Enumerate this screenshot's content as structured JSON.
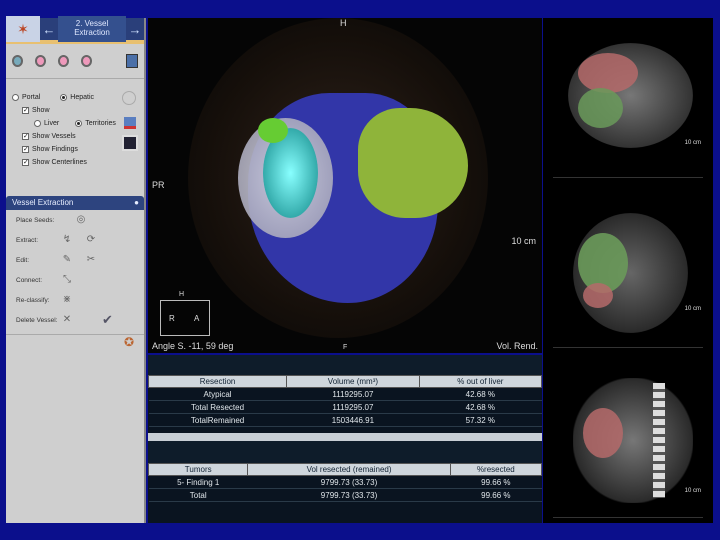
{
  "toolbar": {
    "step": "2. Vessel Extraction",
    "back": "←",
    "next": "→"
  },
  "options": {
    "portal": "Portal",
    "hepatic": "Hepatic",
    "show": "Show",
    "liver": "Liver",
    "territories": "Territories",
    "show_vessels": "Show Vessels",
    "show_findings": "Show Findings",
    "show_centerlines": "Show Centerlines"
  },
  "vessel_panel": {
    "title": "Vessel Extraction",
    "close": "●",
    "rows": [
      {
        "label": "Place Seeds:"
      },
      {
        "label": "Extract:"
      },
      {
        "label": "Edit:"
      },
      {
        "label": "Connect:"
      },
      {
        "label": "Re-classify:"
      },
      {
        "label": "Delete Vessel:"
      }
    ]
  },
  "view3d": {
    "pr": "PR",
    "top": "H",
    "scale": "10 cm",
    "angle": "Angle S. -11, 59 deg",
    "mode": "Vol. Rend.",
    "foot": "F",
    "cube_h": "H",
    "cube_r": "R",
    "cube_a": "A"
  },
  "resection_table": {
    "headers": [
      "Resection",
      "Volume (mm³)",
      "% out of liver"
    ],
    "rows": [
      [
        "Atypical",
        "1119295.07",
        "42.68 %"
      ],
      [
        "Total Resected",
        "1119295.07",
        "42.68 %"
      ],
      [
        "TotalRemained",
        "1503446.91",
        "57.32 %"
      ]
    ]
  },
  "tumor_table": {
    "headers": [
      "Tumors",
      "Vol resected (remained)",
      "%resected"
    ],
    "rows": [
      [
        "5- Finding 1",
        "9799.73 (33.73)",
        "99.66 %"
      ],
      [
        "Total",
        "9799.73 (33.73)",
        "99.66 %"
      ]
    ]
  },
  "ct_views": {
    "scale": "10 cm"
  },
  "colors": {
    "accent": "#2d447f",
    "liver_blue": "#3a3fb0",
    "liver_green": "#8fb43a"
  }
}
